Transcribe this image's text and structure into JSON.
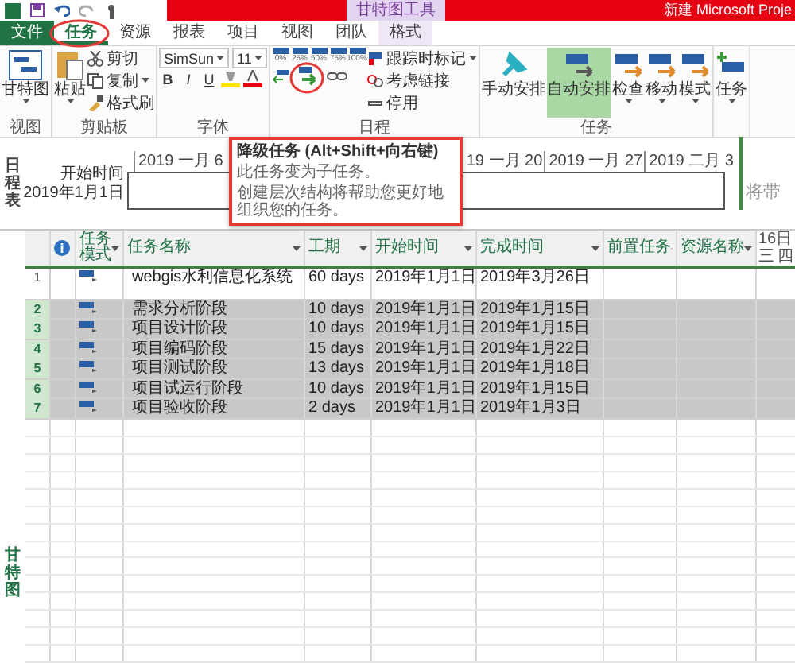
{
  "title_bar": {
    "context_label": "甘特图工具",
    "title": "新建 Microsoft Proje"
  },
  "tabs": [
    {
      "label": "文件",
      "kind": "file",
      "selected": false
    },
    {
      "label": "任务",
      "kind": "normal",
      "selected": true
    },
    {
      "label": "资源",
      "kind": "normal",
      "selected": false
    },
    {
      "label": "报表",
      "kind": "normal",
      "selected": false
    },
    {
      "label": "项目",
      "kind": "normal",
      "selected": false
    },
    {
      "label": "视图",
      "kind": "normal",
      "selected": false
    },
    {
      "label": "团队",
      "kind": "normal",
      "selected": false
    },
    {
      "label": "格式",
      "kind": "context",
      "selected": false
    }
  ],
  "ribbon": {
    "view": {
      "button": "甘特图",
      "label": "视图"
    },
    "clipboard": {
      "paste": "粘贴",
      "cut": "剪切",
      "copy": "复制",
      "painter": "格式刷",
      "label": "剪贴板"
    },
    "font": {
      "family": "SimSun",
      "size": "11",
      "bold": "B",
      "italic": "I",
      "underline": "U",
      "label": "字体"
    },
    "schedule": {
      "percents": [
        "0%",
        "25%",
        "50%",
        "75%",
        "100%"
      ],
      "track": "跟踪时标记",
      "respect_links": "考虑链接",
      "inactivate": "停用",
      "label": "日程"
    },
    "tasks": {
      "buttons": [
        {
          "label": "手动安排",
          "kind": "plain",
          "selected": false
        },
        {
          "label": "自动安排",
          "kind": "plain",
          "selected": true
        },
        {
          "label": "检查",
          "kind": "dropdown",
          "selected": false
        },
        {
          "label": "移动",
          "kind": "dropdown",
          "selected": false
        },
        {
          "label": "模式",
          "kind": "dropdown",
          "selected": false
        }
      ],
      "label": "任务"
    },
    "insert": {
      "button": "任务"
    }
  },
  "timeline": {
    "side_label": "日程表",
    "start_label": "开始时间",
    "start_date": "2019年1月1日",
    "ticks": [
      {
        "label": "2019 一月 6",
        "covered": false
      },
      {
        "label": "19 一月 20",
        "covered": true
      },
      {
        "label": "2019 一月 27",
        "covered": false
      },
      {
        "label": "2019 二月 3",
        "covered": false
      }
    ],
    "hint": "将带"
  },
  "tooltip": {
    "title": "降级任务 (Alt+Shift+向右键)",
    "lines": [
      "此任务变为子任务。",
      "创建层次结构将帮助您更好地组织您的任务。"
    ]
  },
  "table": {
    "side_label": "甘特图",
    "columns": [
      {
        "label": "任务模式",
        "kind": "mode"
      },
      {
        "label": "任务名称",
        "kind": "text"
      },
      {
        "label": "工期",
        "kind": "text"
      },
      {
        "label": "开始时间",
        "kind": "text"
      },
      {
        "label": "完成时间",
        "kind": "text"
      },
      {
        "label": "前置任务",
        "kind": "text"
      },
      {
        "label": "资源名称",
        "kind": "text"
      }
    ],
    "gantt_header": {
      "date": "16日",
      "days": [
        "三",
        "四"
      ]
    },
    "rows": [
      {
        "id": "1",
        "name": "webgis水利信息化系统",
        "duration": "60 days",
        "start": "2019年1月1日",
        "finish": "2019年3月26日",
        "selected": false
      },
      {
        "id": "2",
        "name": "需求分析阶段",
        "duration": "10 days",
        "start": "2019年1月1日",
        "finish": "2019年1月15日",
        "selected": true
      },
      {
        "id": "3",
        "name": "项目设计阶段",
        "duration": "10 days",
        "start": "2019年1月1日",
        "finish": "2019年1月15日",
        "selected": true
      },
      {
        "id": "4",
        "name": "项目编码阶段",
        "duration": "15 days",
        "start": "2019年1月1日",
        "finish": "2019年1月22日",
        "selected": true
      },
      {
        "id": "5",
        "name": "项目测试阶段",
        "duration": "13 days",
        "start": "2019年1月1日",
        "finish": "2019年1月18日",
        "selected": true
      },
      {
        "id": "6",
        "name": "项目试运行阶段",
        "duration": "10 days",
        "start": "2019年1月1日",
        "finish": "2019年1月15日",
        "selected": true
      },
      {
        "id": "7",
        "name": "项目验收阶段",
        "duration": "2 days",
        "start": "2019年1月1日",
        "finish": "2019年1月3日",
        "selected": true
      }
    ]
  }
}
